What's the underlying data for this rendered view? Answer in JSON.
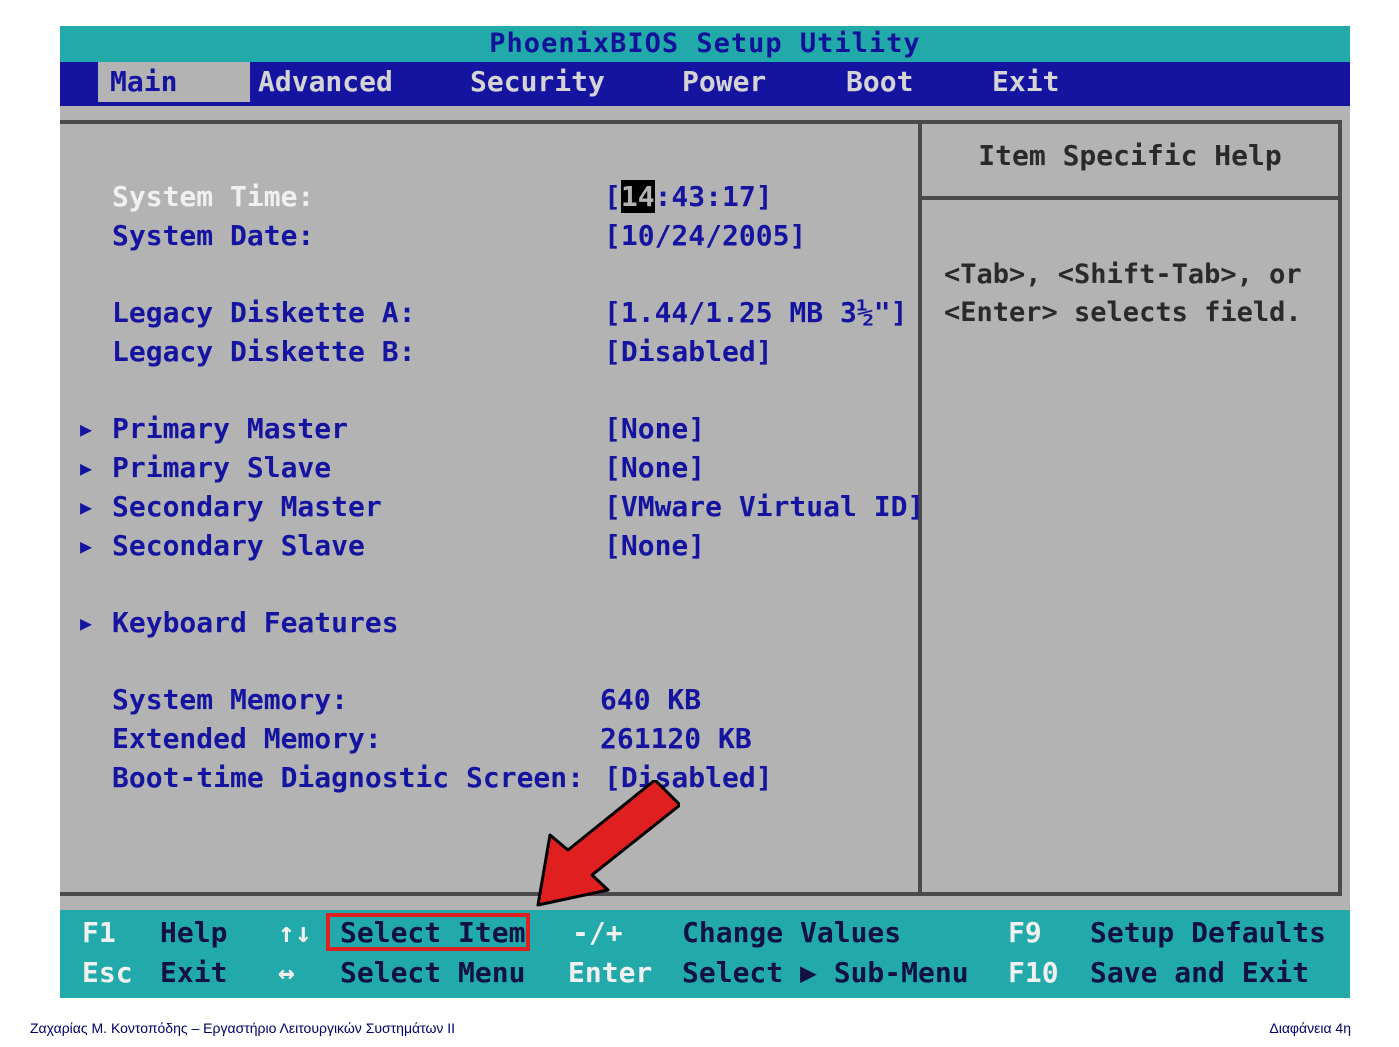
{
  "title": "PhoenixBIOS Setup Utility",
  "menu": [
    {
      "label": "Main"
    },
    {
      "label": "Advanced"
    },
    {
      "label": "Security"
    },
    {
      "label": "Power"
    },
    {
      "label": "Boot"
    },
    {
      "label": "Exit"
    }
  ],
  "main": {
    "system_time": {
      "label": "System Time:",
      "open": "[",
      "cursor": "14",
      "rest": ":43:17]"
    },
    "system_date": {
      "label": "System Date:",
      "value": "[10/24/2005]"
    },
    "diskette_a": {
      "label": "Legacy Diskette A:",
      "value": "[1.44/1.25 MB  3½\"]"
    },
    "diskette_b": {
      "label": "Legacy Diskette B:",
      "value": "[Disabled]"
    },
    "primary_master": {
      "label": "Primary Master",
      "value": "[None]"
    },
    "primary_slave": {
      "label": "Primary Slave",
      "value": "[None]"
    },
    "secondary_master": {
      "label": "Secondary Master",
      "value": "[VMware Virtual ID]"
    },
    "secondary_slave": {
      "label": "Secondary Slave",
      "value": "[None]"
    },
    "keyboard_features": {
      "label": "Keyboard Features"
    },
    "system_memory": {
      "label": "System Memory:",
      "value": "640 KB"
    },
    "extended_memory": {
      "label": "Extended Memory:",
      "value": "261120 KB"
    },
    "boot_diag": {
      "label": "Boot-time Diagnostic Screen:",
      "value": "[Disabled]"
    }
  },
  "submenu_arrow": "▶",
  "help": {
    "title": "Item Specific Help",
    "line1": "<Tab>, <Shift-Tab>, or",
    "line2": "<Enter> selects field."
  },
  "footer": {
    "f1": "F1",
    "help": "Help",
    "updown": "↑↓",
    "select_item": "Select Item",
    "minusplus": "-/+",
    "change_values": "Change Values",
    "f9": "F9",
    "setup_defaults": "Setup Defaults",
    "esc": "Esc",
    "exit": "Exit",
    "leftright": "↔",
    "select_menu": "Select Menu",
    "enter": "Enter",
    "select_submenu": "Select ▶ Sub-Menu",
    "f10": "F10",
    "save_exit": "Save and Exit"
  },
  "caption": {
    "left": "Ζαχαρίας Μ. Κοντοπόδης – Εργαστήριο Λειτουργικών Συστημάτων ΙΙ",
    "right": "Διαφάνεια 4η"
  },
  "colors": {
    "bios_gray": "#b3b3b3",
    "bios_blue": "#1414a0",
    "bios_cyan": "#22aaaa",
    "highlight_red": "#e02020"
  }
}
